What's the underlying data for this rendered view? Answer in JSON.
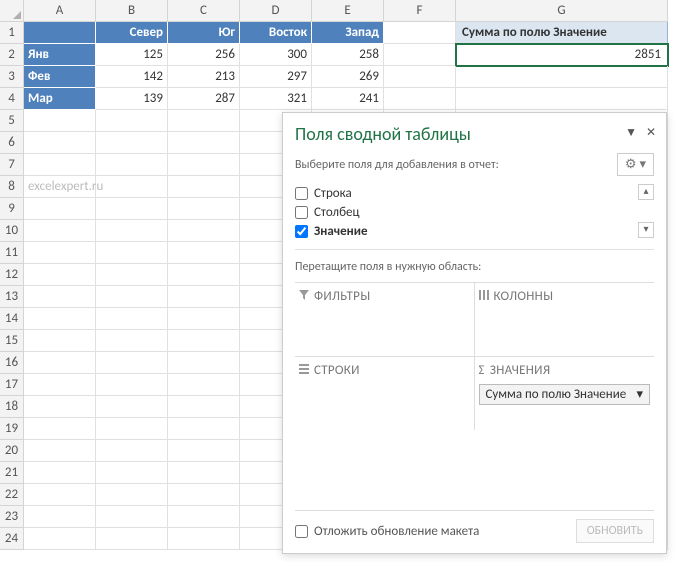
{
  "columns": [
    "A",
    "B",
    "C",
    "D",
    "E",
    "F",
    "G"
  ],
  "rows": [
    "1",
    "2",
    "3",
    "4",
    "5",
    "6",
    "7",
    "8",
    "9",
    "10",
    "11",
    "12",
    "13",
    "14",
    "15",
    "16",
    "17",
    "18",
    "19",
    "20",
    "21",
    "22",
    "23",
    "24"
  ],
  "table": {
    "headers": [
      "",
      "Север",
      "Юг",
      "Восток",
      "Запад"
    ],
    "data": [
      {
        "a": "Янв",
        "b": "125",
        "c": "256",
        "d": "300",
        "e": "258"
      },
      {
        "a": "Фев",
        "b": "142",
        "c": "213",
        "d": "297",
        "e": "269"
      },
      {
        "a": "Мар",
        "b": "139",
        "c": "287",
        "d": "321",
        "e": "241"
      }
    ]
  },
  "watermark": "excelexpert.ru",
  "pivot": {
    "header": "Сумма по полю Значение",
    "value": "2851"
  },
  "pane": {
    "title": "Поля сводной таблицы",
    "choose": "Выберите поля для добавления в отчет:",
    "fields": [
      {
        "label": "Строка",
        "checked": false
      },
      {
        "label": "Столбец",
        "checked": false
      },
      {
        "label": "Значение",
        "checked": true
      }
    ],
    "drag": "Перетащите поля в нужную область:",
    "zones": {
      "filters": "ФИЛЬТРЫ",
      "cols": "КОЛОННЫ",
      "rows": "СТРОКИ",
      "vals": "ЗНАЧЕНИЯ"
    },
    "valpill": "Сумма по полю Значение",
    "defer": "Отложить обновление макета",
    "update": "ОБНОВИТЬ"
  }
}
